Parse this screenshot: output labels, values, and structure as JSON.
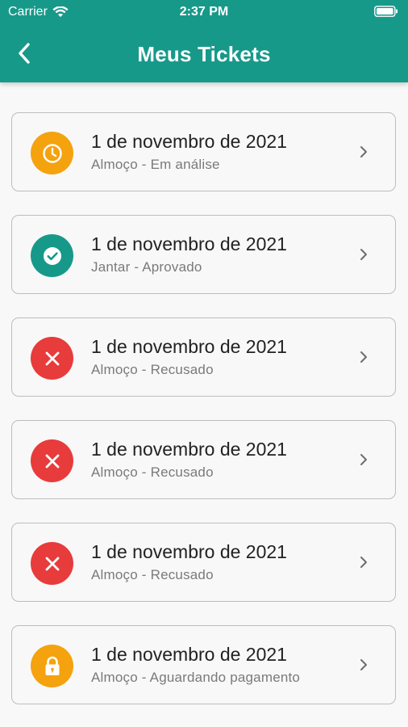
{
  "status_bar": {
    "carrier": "Carrier",
    "time": "2:37 PM"
  },
  "app_bar": {
    "title": "Meus Tickets",
    "back_icon": "chevron-left-icon"
  },
  "colors": {
    "primary": "#17998a",
    "pending": "#f5a20f",
    "approved": "#17998a",
    "rejected": "#e83b3b"
  },
  "tickets": [
    {
      "date": "1 de novembro de 2021",
      "subtitle": "Almoço - Em análise",
      "status": "pending",
      "icon": "clock-icon"
    },
    {
      "date": "1 de novembro de 2021",
      "subtitle": "Jantar - Aprovado",
      "status": "approved",
      "icon": "check-icon"
    },
    {
      "date": "1 de novembro de 2021",
      "subtitle": "Almoço - Recusado",
      "status": "rejected",
      "icon": "close-icon"
    },
    {
      "date": "1 de novembro de 2021",
      "subtitle": "Almoço - Recusado",
      "status": "rejected",
      "icon": "close-icon"
    },
    {
      "date": "1 de novembro de 2021",
      "subtitle": "Almoço - Recusado",
      "status": "rejected",
      "icon": "close-icon"
    },
    {
      "date": "1 de novembro de 2021",
      "subtitle": "Almoço - Aguardando pagamento",
      "status": "awaiting-payment",
      "icon": "lock-icon"
    }
  ]
}
